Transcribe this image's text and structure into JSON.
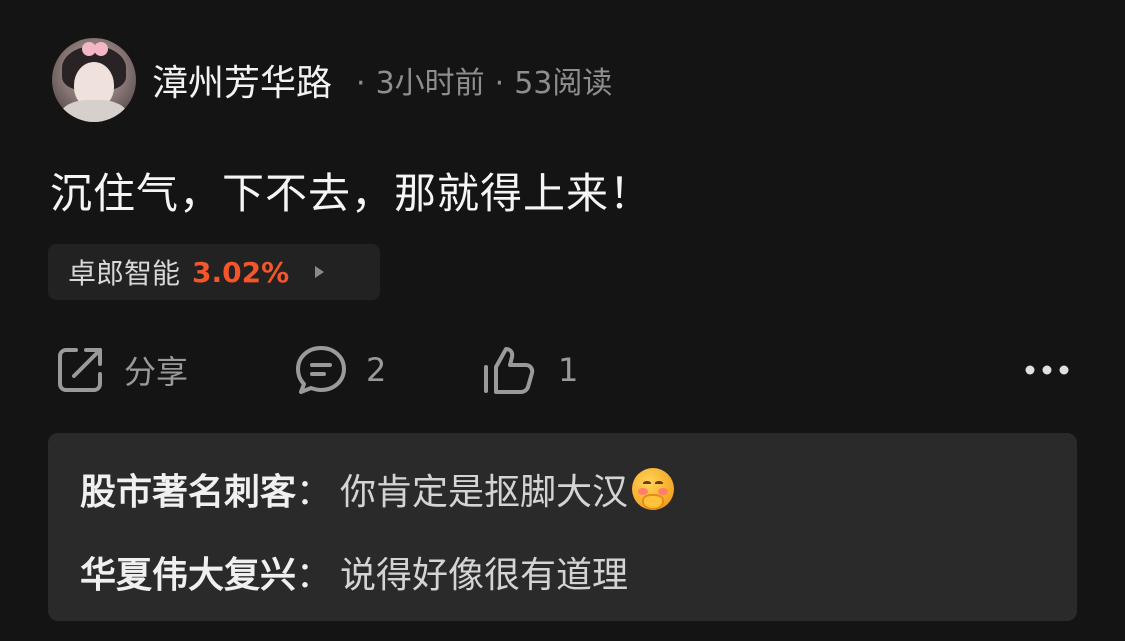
{
  "post": {
    "username": "漳州芳华路",
    "time": "3小时前",
    "reads": "53阅读",
    "separator": "·",
    "text": "沉住气，下不去，那就得上来！",
    "stock": {
      "name": "卓郎智能",
      "change": "3.02%",
      "change_color": "#f5552a"
    }
  },
  "actions": {
    "share_label": "分享",
    "comment_count": "2",
    "like_count": "1"
  },
  "comments": [
    {
      "user": "股市著名刺客",
      "colon": "：",
      "text": "你肯定是抠脚大汉",
      "emoji": "shy-hug-emoji"
    },
    {
      "user": "华夏伟大复兴",
      "colon": "：",
      "text": "说得好像很有道理"
    }
  ]
}
